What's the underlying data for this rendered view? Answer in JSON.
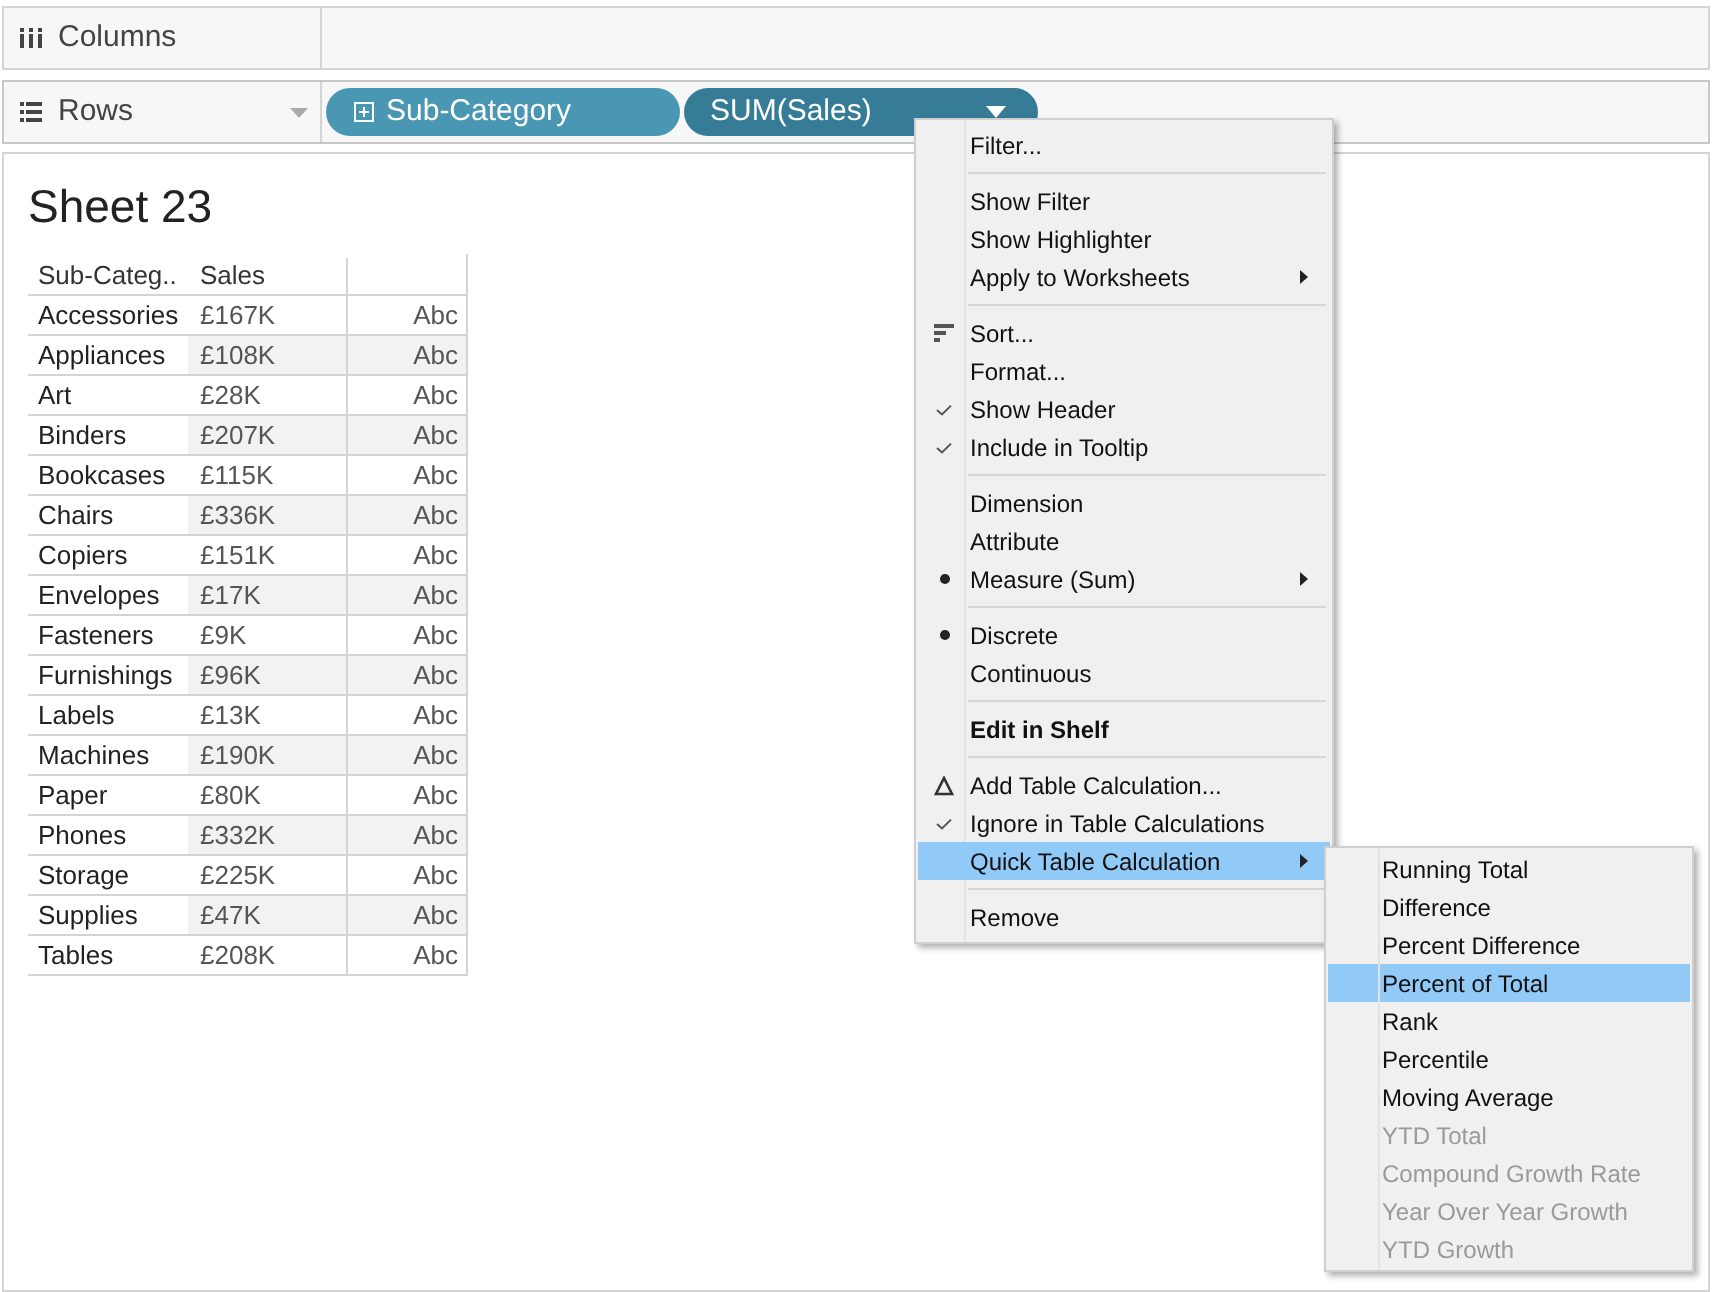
{
  "columns_shelf": {
    "label": "Columns"
  },
  "rows_shelf": {
    "label": "Rows",
    "pills": [
      {
        "label": "Sub-Category",
        "kind": "dimension"
      },
      {
        "label": "SUM(Sales)",
        "kind": "measure"
      }
    ]
  },
  "sheet": {
    "title": "Sheet 23",
    "table": {
      "columns": [
        "Sub-Categ..",
        "Sales"
      ],
      "rows": [
        {
          "sub_category": "Accessories",
          "sales": "£167K",
          "mark": "Abc"
        },
        {
          "sub_category": "Appliances",
          "sales": "£108K",
          "mark": "Abc"
        },
        {
          "sub_category": "Art",
          "sales": "£28K",
          "mark": "Abc"
        },
        {
          "sub_category": "Binders",
          "sales": "£207K",
          "mark": "Abc"
        },
        {
          "sub_category": "Bookcases",
          "sales": "£115K",
          "mark": "Abc"
        },
        {
          "sub_category": "Chairs",
          "sales": "£336K",
          "mark": "Abc"
        },
        {
          "sub_category": "Copiers",
          "sales": "£151K",
          "mark": "Abc"
        },
        {
          "sub_category": "Envelopes",
          "sales": "£17K",
          "mark": "Abc"
        },
        {
          "sub_category": "Fasteners",
          "sales": "£9K",
          "mark": "Abc"
        },
        {
          "sub_category": "Furnishings",
          "sales": "£96K",
          "mark": "Abc"
        },
        {
          "sub_category": "Labels",
          "sales": "£13K",
          "mark": "Abc"
        },
        {
          "sub_category": "Machines",
          "sales": "£190K",
          "mark": "Abc"
        },
        {
          "sub_category": "Paper",
          "sales": "£80K",
          "mark": "Abc"
        },
        {
          "sub_category": "Phones",
          "sales": "£332K",
          "mark": "Abc"
        },
        {
          "sub_category": "Storage",
          "sales": "£225K",
          "mark": "Abc"
        },
        {
          "sub_category": "Supplies",
          "sales": "£47K",
          "mark": "Abc"
        },
        {
          "sub_category": "Tables",
          "sales": "£208K",
          "mark": "Abc"
        }
      ]
    }
  },
  "context_menu": {
    "groups": [
      {
        "items": [
          {
            "kind": "plain",
            "label": "Filter...",
            "submenu": false,
            "bold": false,
            "selected": false
          }
        ]
      },
      {
        "items": [
          {
            "kind": "plain",
            "label": "Show Filter",
            "submenu": false,
            "bold": false,
            "selected": false
          },
          {
            "kind": "plain",
            "label": "Show Highlighter",
            "submenu": false,
            "bold": false,
            "selected": false
          },
          {
            "kind": "plain",
            "label": "Apply to Worksheets",
            "submenu": true,
            "bold": false,
            "selected": false
          }
        ]
      },
      {
        "items": [
          {
            "kind": "sort",
            "label": "Sort...",
            "submenu": false,
            "bold": false,
            "selected": false
          },
          {
            "kind": "plain",
            "label": "Format...",
            "submenu": false,
            "bold": false,
            "selected": false
          },
          {
            "kind": "check",
            "label": "Show Header",
            "submenu": false,
            "bold": false,
            "selected": false
          },
          {
            "kind": "check",
            "label": "Include in Tooltip",
            "submenu": false,
            "bold": false,
            "selected": false
          }
        ]
      },
      {
        "items": [
          {
            "kind": "plain",
            "label": "Dimension",
            "submenu": false,
            "bold": false,
            "selected": false
          },
          {
            "kind": "plain",
            "label": "Attribute",
            "submenu": false,
            "bold": false,
            "selected": false
          },
          {
            "kind": "bullet",
            "label": "Measure (Sum)",
            "submenu": true,
            "bold": false,
            "selected": false
          }
        ]
      },
      {
        "items": [
          {
            "kind": "bullet",
            "label": "Discrete",
            "submenu": false,
            "bold": false,
            "selected": false
          },
          {
            "kind": "plain",
            "label": "Continuous",
            "submenu": false,
            "bold": false,
            "selected": false
          }
        ]
      },
      {
        "items": [
          {
            "kind": "plain",
            "label": "Edit in Shelf",
            "submenu": false,
            "bold": true,
            "selected": false
          }
        ]
      },
      {
        "items": [
          {
            "kind": "delta",
            "label": "Add Table Calculation...",
            "submenu": false,
            "bold": false,
            "selected": false
          },
          {
            "kind": "check",
            "label": "Ignore in Table Calculations",
            "submenu": false,
            "bold": false,
            "selected": false
          },
          {
            "kind": "plain",
            "label": "Quick Table Calculation",
            "submenu": true,
            "bold": false,
            "selected": true
          }
        ]
      },
      {
        "items": [
          {
            "kind": "plain",
            "label": "Remove",
            "submenu": false,
            "bold": false,
            "selected": false
          }
        ]
      }
    ]
  },
  "submenu": {
    "items": [
      {
        "label": "Running Total",
        "disabled": false,
        "selected": false
      },
      {
        "label": "Difference",
        "disabled": false,
        "selected": false
      },
      {
        "label": "Percent Difference",
        "disabled": false,
        "selected": false
      },
      {
        "label": "Percent of Total",
        "disabled": false,
        "selected": true
      },
      {
        "label": "Rank",
        "disabled": false,
        "selected": false
      },
      {
        "label": "Percentile",
        "disabled": false,
        "selected": false
      },
      {
        "label": "Moving Average",
        "disabled": false,
        "selected": false
      },
      {
        "label": "YTD Total",
        "disabled": true,
        "selected": false
      },
      {
        "label": "Compound Growth Rate",
        "disabled": true,
        "selected": false
      },
      {
        "label": "Year Over Year Growth",
        "disabled": true,
        "selected": false
      },
      {
        "label": "YTD Growth",
        "disabled": true,
        "selected": false
      }
    ]
  }
}
